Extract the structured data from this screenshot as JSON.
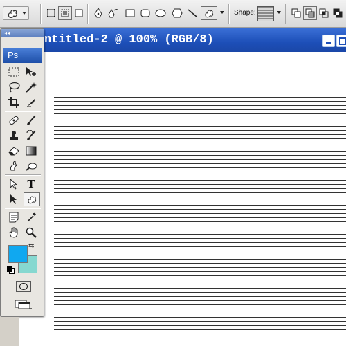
{
  "options_bar": {
    "tool_preset_icon": "custom-shape-icon",
    "path_modes": [
      "shape-layers-icon",
      "paths-icon",
      "fill-pixels-icon"
    ],
    "pen_tools": [
      "pen-icon",
      "freeform-pen-icon"
    ],
    "shape_tools": [
      "rectangle-icon",
      "rounded-rectangle-icon",
      "ellipse-icon",
      "polygon-icon",
      "line-icon",
      "custom-shape-icon"
    ],
    "shape_label": "Shape:",
    "shape_picker_icon": "horizontal-lines-shape-icon",
    "combine_modes": [
      "add-icon",
      "subtract-icon",
      "intersect-icon",
      "exclude-icon"
    ]
  },
  "document": {
    "title": "ntitled-2 @ 100% (RGB/8)",
    "line_count": 59
  },
  "toolbox": {
    "logo": "Ps",
    "grip": "◂◂",
    "tools": [
      [
        "marquee-icon",
        "move-icon"
      ],
      [
        "lasso-icon",
        "magic-wand-icon"
      ],
      [
        "crop-icon",
        "slice-icon"
      ],
      [
        "healing-brush-icon",
        "brush-icon"
      ],
      [
        "clone-stamp-icon",
        "history-brush-icon"
      ],
      [
        "eraser-icon",
        "gradient-icon"
      ],
      [
        "blur-icon",
        "dodge-icon"
      ],
      [
        "path-selection-icon",
        "type-icon"
      ],
      [
        "direct-selection-icon",
        "custom-shape-icon"
      ],
      [
        "notes-icon",
        "eyedropper-icon"
      ],
      [
        "hand-icon",
        "zoom-icon"
      ]
    ],
    "type_tool_label": "T",
    "swap_glyph": "⇆",
    "colors": {
      "foreground": "#10a8f0",
      "background": "#86d8d0"
    }
  },
  "colors": {
    "title_bar": "#1d4fb8",
    "toolbox_bg": "#e8e6e1"
  }
}
